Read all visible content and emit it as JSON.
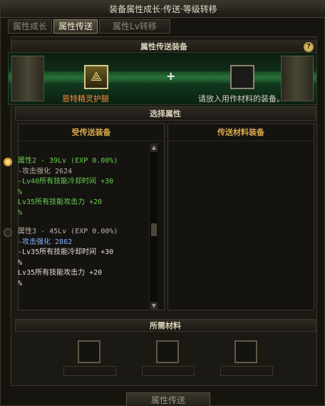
{
  "window": {
    "title": "装备属性成长·传送·等级转移"
  },
  "tabs": [
    {
      "label": "属性成长",
      "active": false
    },
    {
      "label": "属性传送",
      "active": true
    },
    {
      "label": "属性Lv转移",
      "active": false
    }
  ],
  "transfer_section": {
    "heading": "属性传送装备",
    "help_icon": "?",
    "source_item_name": "恩特精灵护腿",
    "plus_sign": "+",
    "target_hint": "请放入用作材料的装备。"
  },
  "select_section": {
    "heading": "选择属性",
    "left_column_header": "受传送装备",
    "right_column_header": "传送材料装备",
    "options": [
      {
        "selected": true,
        "title": "属性2 - 39Lv (EXP 0.00%)",
        "lines": [
          "-攻击强化 2624",
          "-Lv40所有技能冷却时间 +30",
          "%",
          " Lv35所有技能攻击力 +20",
          "%"
        ]
      },
      {
        "selected": false,
        "title": "属性3 - 45Lv (EXP 0.00%)",
        "lines": [
          "-攻击强化 2862",
          "-Lv35所有技能冷却时间 +30",
          "%",
          " Lv35所有技能攻击力 +20",
          "%"
        ]
      }
    ]
  },
  "materials_section": {
    "heading": "所需材料"
  },
  "action": {
    "label": "属性传送"
  },
  "colors": {
    "accent_gold": "#d8a84a",
    "item_orange": "#ff8a3d",
    "option_green": "#67d04e",
    "link_blue": "#7fb2ff"
  }
}
